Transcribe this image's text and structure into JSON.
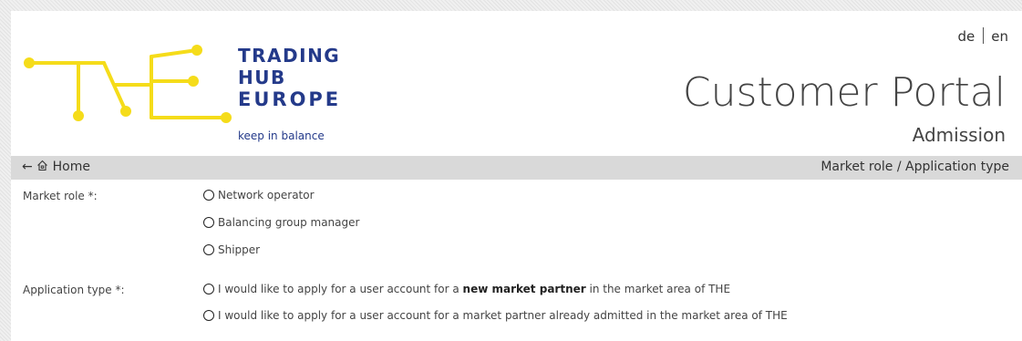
{
  "header": {
    "brand_lines": [
      "TRADING",
      "HUB",
      "EUROPE"
    ],
    "tagline": "keep in balance",
    "lang_de": "de",
    "lang_en": "en",
    "portal_title": "Customer Portal",
    "portal_subtitle": "Admission"
  },
  "navbar": {
    "home_label": "Home",
    "breadcrumb": "Market role / Application type"
  },
  "form": {
    "market_role_label": "Market role *:",
    "market_role_options": [
      "Network operator",
      "Balancing group manager",
      "Shipper"
    ],
    "application_type_label": "Application type *:",
    "application_options": [
      {
        "pre": "I would like to apply for a user account for a ",
        "bold": "new market partner",
        "post": " in the market area of THE"
      },
      {
        "pre": "I would like to apply for a user account for a market partner already admitted in the market area of THE",
        "bold": "",
        "post": ""
      }
    ]
  },
  "colors": {
    "logo_yellow": "#f5dc1a",
    "brand_blue": "#243a8a",
    "navbar_gray": "#d9d9d9"
  }
}
